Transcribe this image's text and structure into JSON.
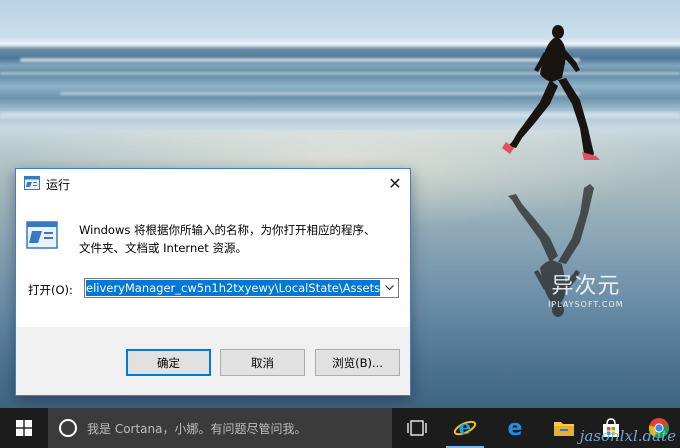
{
  "desktop": {
    "watermark_logo": "异次元",
    "watermark_domain": "IPLAYSOFT.COM",
    "site_mark": "jasonlxl.date"
  },
  "run_dialog": {
    "title": "运行",
    "close_glyph": "✕",
    "description_line1": "Windows 将根据你所输入的名称，为你打开相应的程序、",
    "description_line2": "文件夹、文档或 Internet 资源。",
    "open_label": "打开(O):",
    "open_value": "eliveryManager_cw5n1h2txyewy\\LocalState\\Assets",
    "buttons": {
      "ok": "确定",
      "cancel": "取消",
      "browse": "浏览(B)..."
    }
  },
  "taskbar": {
    "search_placeholder": "我是 Cortana，小娜。有问题尽管问我。",
    "pinned": [
      "task-view",
      "internet-explorer",
      "edge",
      "file-explorer",
      "store",
      "chrome"
    ]
  },
  "colors": {
    "accent": "#0078d7",
    "taskbar": "#1c1c1c",
    "search_box": "#3b3b3b",
    "dialog_footer": "#f0f0f0"
  }
}
